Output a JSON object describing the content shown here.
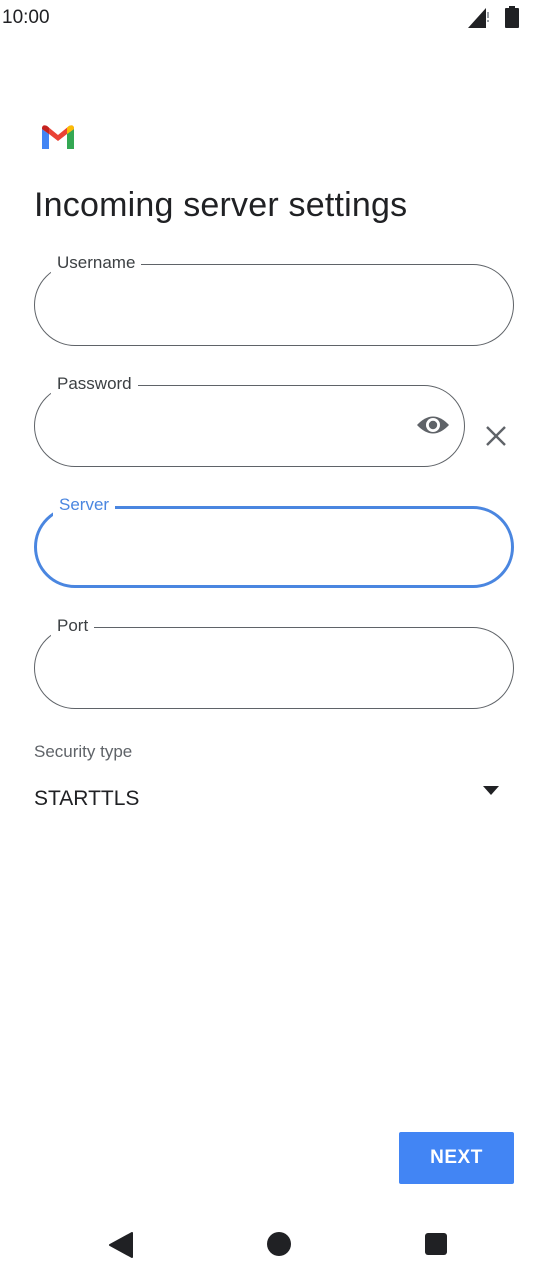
{
  "status_bar": {
    "time": "10:00",
    "icons": [
      "signal-icon",
      "battery-icon"
    ]
  },
  "app": {
    "logo": "gmail-logo",
    "colors": {
      "accent": "#4285f4",
      "focus": "#4a86e0",
      "outline": "#5f6368"
    }
  },
  "page": {
    "title": "Incoming server settings"
  },
  "form": {
    "username": {
      "label": "Username",
      "value": ""
    },
    "password": {
      "label": "Password",
      "value": "",
      "toggle_icon": "eye-icon",
      "clear_icon": "close-icon"
    },
    "server": {
      "label": "Server",
      "value": "",
      "focused": true
    },
    "port": {
      "label": "Port",
      "value": ""
    },
    "security": {
      "label": "Security type",
      "selected": "STARTTLS",
      "icon": "dropdown-arrow-icon"
    }
  },
  "actions": {
    "next_label": "NEXT"
  },
  "nav_bar": {
    "icons": [
      "back-icon",
      "home-icon",
      "recents-icon"
    ]
  }
}
